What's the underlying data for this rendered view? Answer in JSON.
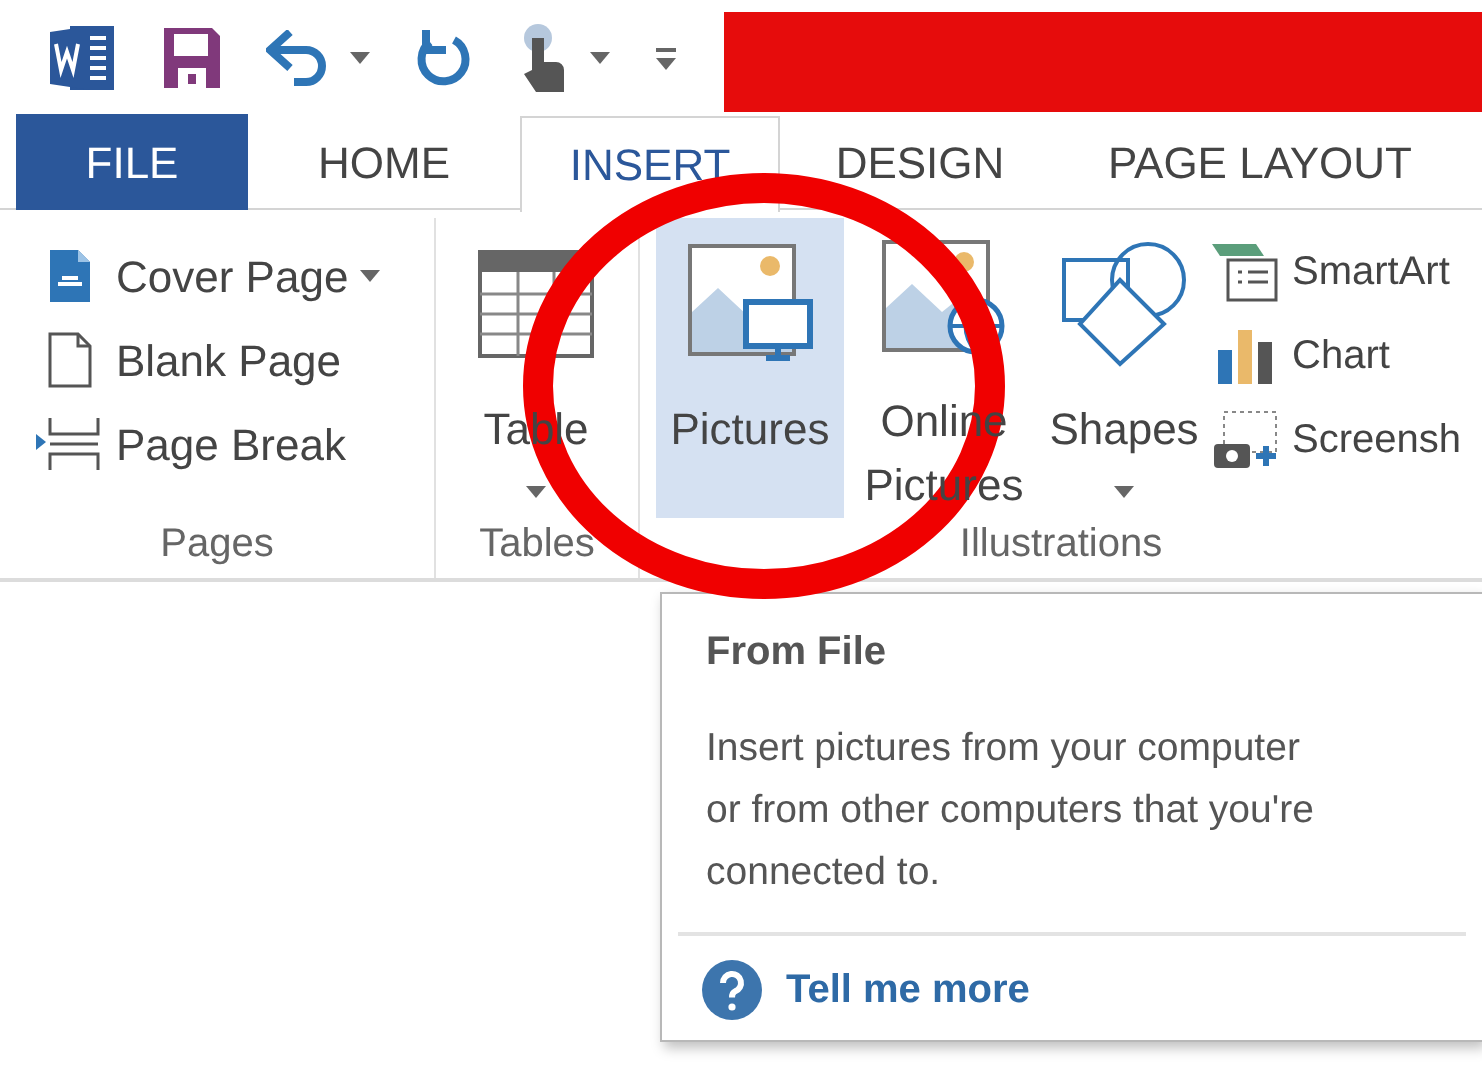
{
  "quick_access": [
    {
      "kind": "word",
      "dropdown": false
    },
    {
      "kind": "save",
      "dropdown": false
    },
    {
      "kind": "undo",
      "dropdown": true
    },
    {
      "kind": "redo",
      "dropdown": false
    },
    {
      "kind": "touch",
      "dropdown": true
    },
    {
      "kind": "customize",
      "dropdown": false
    }
  ],
  "tabs": [
    {
      "label": "FILE",
      "kind": "file",
      "selected": false
    },
    {
      "label": "HOME",
      "kind": "tab",
      "selected": false
    },
    {
      "label": "INSERT",
      "kind": "tab",
      "selected": true
    },
    {
      "label": "DESIGN",
      "kind": "tab",
      "selected": false
    },
    {
      "label": "PAGE LAYOUT",
      "kind": "tab",
      "selected": false
    }
  ],
  "groups": [
    {
      "label": "Pages",
      "items": [
        {
          "kind": "cover",
          "label": "Cover Page",
          "dropdown": true
        },
        {
          "kind": "blank",
          "label": "Blank Page",
          "dropdown": false
        },
        {
          "kind": "break",
          "label": "Page Break",
          "dropdown": false
        }
      ]
    },
    {
      "label": "Tables",
      "large": [
        {
          "kind": "table",
          "label": "Table",
          "dropdown": true,
          "highlighted": false
        }
      ]
    },
    {
      "label": "Illustrations",
      "large": [
        {
          "kind": "pictures",
          "label": "Pictures",
          "dropdown": false,
          "highlighted": true
        },
        {
          "kind": "online",
          "label": "Online Pictures",
          "highlighted": false
        },
        {
          "kind": "shapes",
          "label": "Shapes",
          "dropdown": true,
          "highlighted": false
        }
      ],
      "items": [
        {
          "kind": "smartart",
          "label": "SmartArt",
          "dropdown": false
        },
        {
          "kind": "chart",
          "label": "Chart",
          "dropdown": false
        },
        {
          "kind": "screenshot",
          "label": "Screensh",
          "dropdown": false
        }
      ]
    }
  ],
  "tooltip": {
    "title": "From File",
    "body": "Insert pictures from your computer or from other computers that you're connected to.",
    "link": "Tell me more"
  }
}
